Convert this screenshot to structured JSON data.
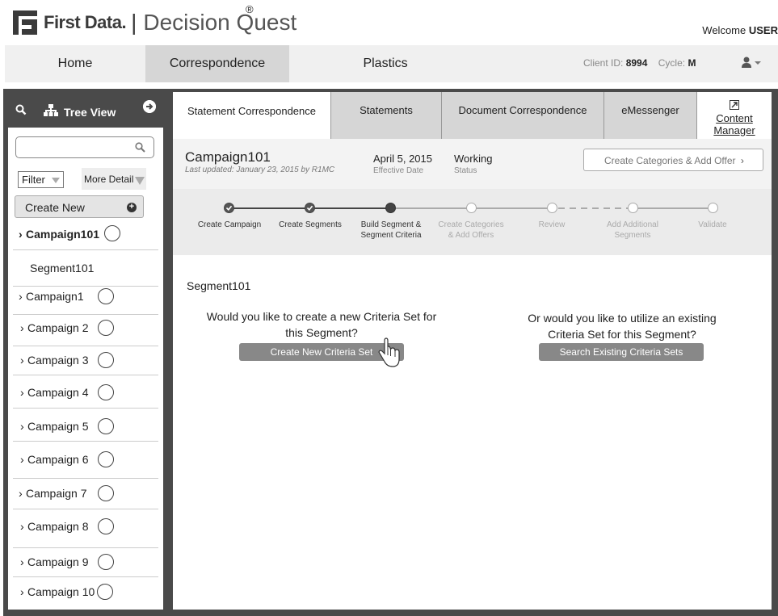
{
  "header": {
    "brand": "First Data.",
    "separator": "|",
    "product": "Decision Quest",
    "registered": "®",
    "welcome_prefix": "Welcome",
    "welcome_user": "USER"
  },
  "nav": {
    "items": [
      {
        "label": "Home"
      },
      {
        "label": "Correspondence"
      },
      {
        "label": "Plastics"
      }
    ],
    "client_id_label": "Client ID:",
    "client_id": "8994",
    "cycle_label": "Cycle:",
    "cycle": "M"
  },
  "sidebar": {
    "tree_view_label": "Tree View",
    "search_placeholder": "",
    "filter_label": "Filter",
    "more_detail_label": "More Detail",
    "create_new_label": "Create New",
    "active_campaign": "Campaign101",
    "active_segment": "Segment101",
    "campaigns": [
      {
        "label": "Campaign1"
      },
      {
        "label": "Campaign 2"
      },
      {
        "label": "Campaign 3"
      },
      {
        "label": "Campaign 4"
      },
      {
        "label": "Campaign 5"
      },
      {
        "label": "Campaign 6"
      },
      {
        "label": "Campaign 7"
      },
      {
        "label": "Campaign 8"
      },
      {
        "label": "Campaign 9"
      },
      {
        "label": "Campaign 10"
      }
    ]
  },
  "tabs": [
    {
      "label": "Statement Correspondence"
    },
    {
      "label": "Statements"
    },
    {
      "label": "Document Correspondence"
    },
    {
      "label": "eMessenger"
    },
    {
      "label": "Content Manager"
    }
  ],
  "campaign": {
    "title": "Campaign101",
    "updated": "Last updated: January 23, 2015 by R1MC",
    "effective_date": "April 5, 2015",
    "effective_date_label": "Effective Date",
    "status": "Working",
    "status_label": "Status",
    "action_label": "Create Categories & Add Offer"
  },
  "steps": [
    {
      "line1": "Create Campaign",
      "line2": "",
      "state": "done"
    },
    {
      "line1": "Create Segments",
      "line2": "",
      "state": "done"
    },
    {
      "line1": "Build Segment &",
      "line2": "Segment Criteria",
      "state": "current"
    },
    {
      "line1": "Create Categories",
      "line2": "& Add Offers",
      "state": "todo"
    },
    {
      "line1": "Review",
      "line2": "",
      "state": "todo"
    },
    {
      "line1": "Add Additional",
      "line2": "Segments",
      "state": "todo"
    },
    {
      "line1": "Validate",
      "line2": "",
      "state": "todo"
    }
  ],
  "main": {
    "segment_title": "Segment101",
    "question_new": "Would you like to create a new Criteria Set for this Segment?",
    "button_new": "Create New Criteria Set",
    "question_existing": "Or would you like to utilize an existing Criteria Set for this Segment?",
    "button_existing": "Search Existing Criteria Sets"
  },
  "colors": {
    "frame": "#4a4a4a",
    "nav_active": "#d6d6d6",
    "button": "#888888"
  }
}
